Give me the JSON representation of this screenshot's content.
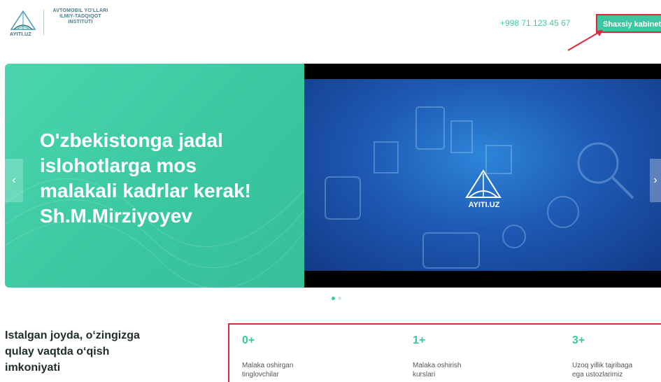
{
  "header": {
    "logo_text": [
      "AVTOMOBIL YO'LLARI",
      "ILMIY-TADQIQOT",
      "INSTITUTI"
    ],
    "logo_caption": "AYITI.UZ",
    "phone": "+998 71 123 45 67",
    "cabinet_label": "Shaxsiy kabinet"
  },
  "slider": {
    "headline_lines": [
      "O'zbekistonga jadal",
      "islohotlarga mos",
      "malakali kadrlar kerak!",
      "Sh.M.Mirziyoyev"
    ],
    "video_caption": "AYITI.UZ",
    "prev_icon": "chevron-left-icon",
    "next_icon": "chevron-right-icon",
    "dot_count": 2,
    "active_dot": 0
  },
  "promo": {
    "lines": [
      "Istalgan joyda, o‘zingizga",
      "qulay vaqtda o‘qish",
      "imkoniyati"
    ]
  },
  "stats": [
    {
      "value": "0+",
      "label_lines": [
        "Malaka oshirgan",
        "tinglovchilar"
      ]
    },
    {
      "value": "1+",
      "label_lines": [
        "Malaka oshirish",
        "kurslari"
      ]
    },
    {
      "value": "3+",
      "label_lines": [
        "Uzoq yillik tajribaga",
        "ega ustozlarimiz"
      ]
    }
  ],
  "colors": {
    "accent": "#3cc7a0",
    "annotation": "#e0263a",
    "video_blue": "#1e5ab5"
  }
}
